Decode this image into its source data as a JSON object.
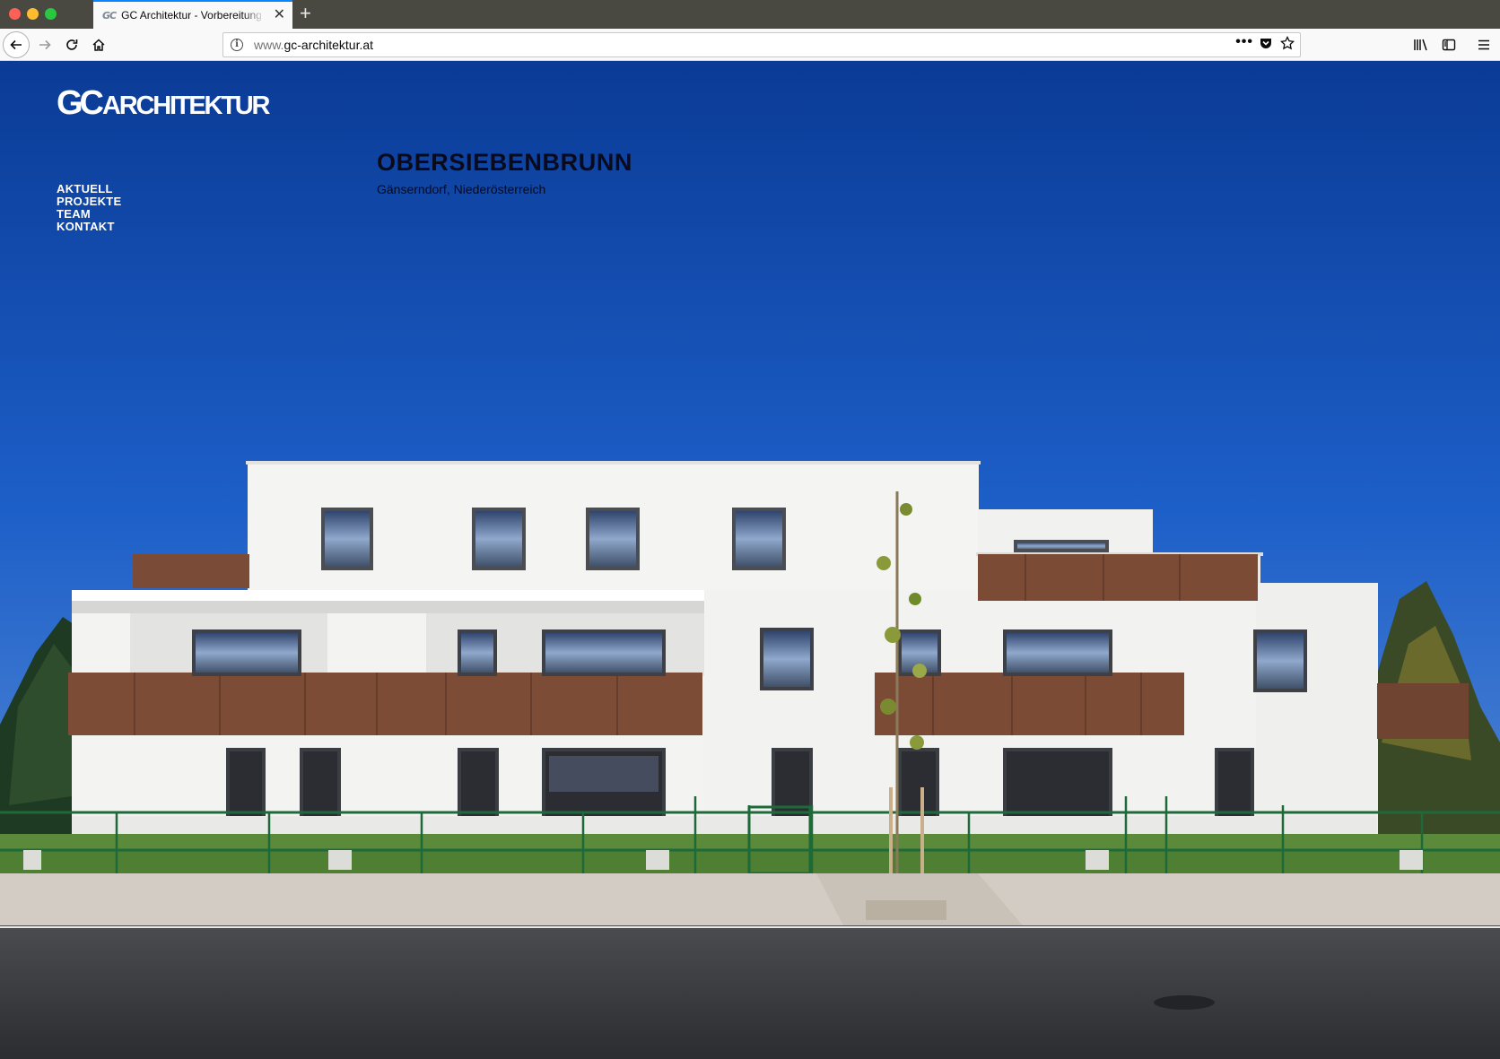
{
  "browser": {
    "tab": {
      "favicon_text": "GC",
      "title": "GC Architektur - Vorbereitung und"
    },
    "url": {
      "prefix": "www.",
      "domain": "gc-architektur.at"
    }
  },
  "site": {
    "logo": {
      "gc": "GC",
      "word": "ARCHITEKTUR"
    },
    "nav": [
      {
        "label": "AKTUELL"
      },
      {
        "label": "PROJEKTE"
      },
      {
        "label": "TEAM"
      },
      {
        "label": "KONTAKT"
      }
    ],
    "project": {
      "title": "OBERSIEBENBRUNN",
      "location": "Gänserndorf, Niederösterreich"
    }
  },
  "colors": {
    "sky_top": "#0b3f9a",
    "sky_bottom": "#5a8fd8",
    "facade": "#f3f3f1",
    "balcony_brown": "#7a4a35",
    "tab_accent": "#0a84ff"
  }
}
